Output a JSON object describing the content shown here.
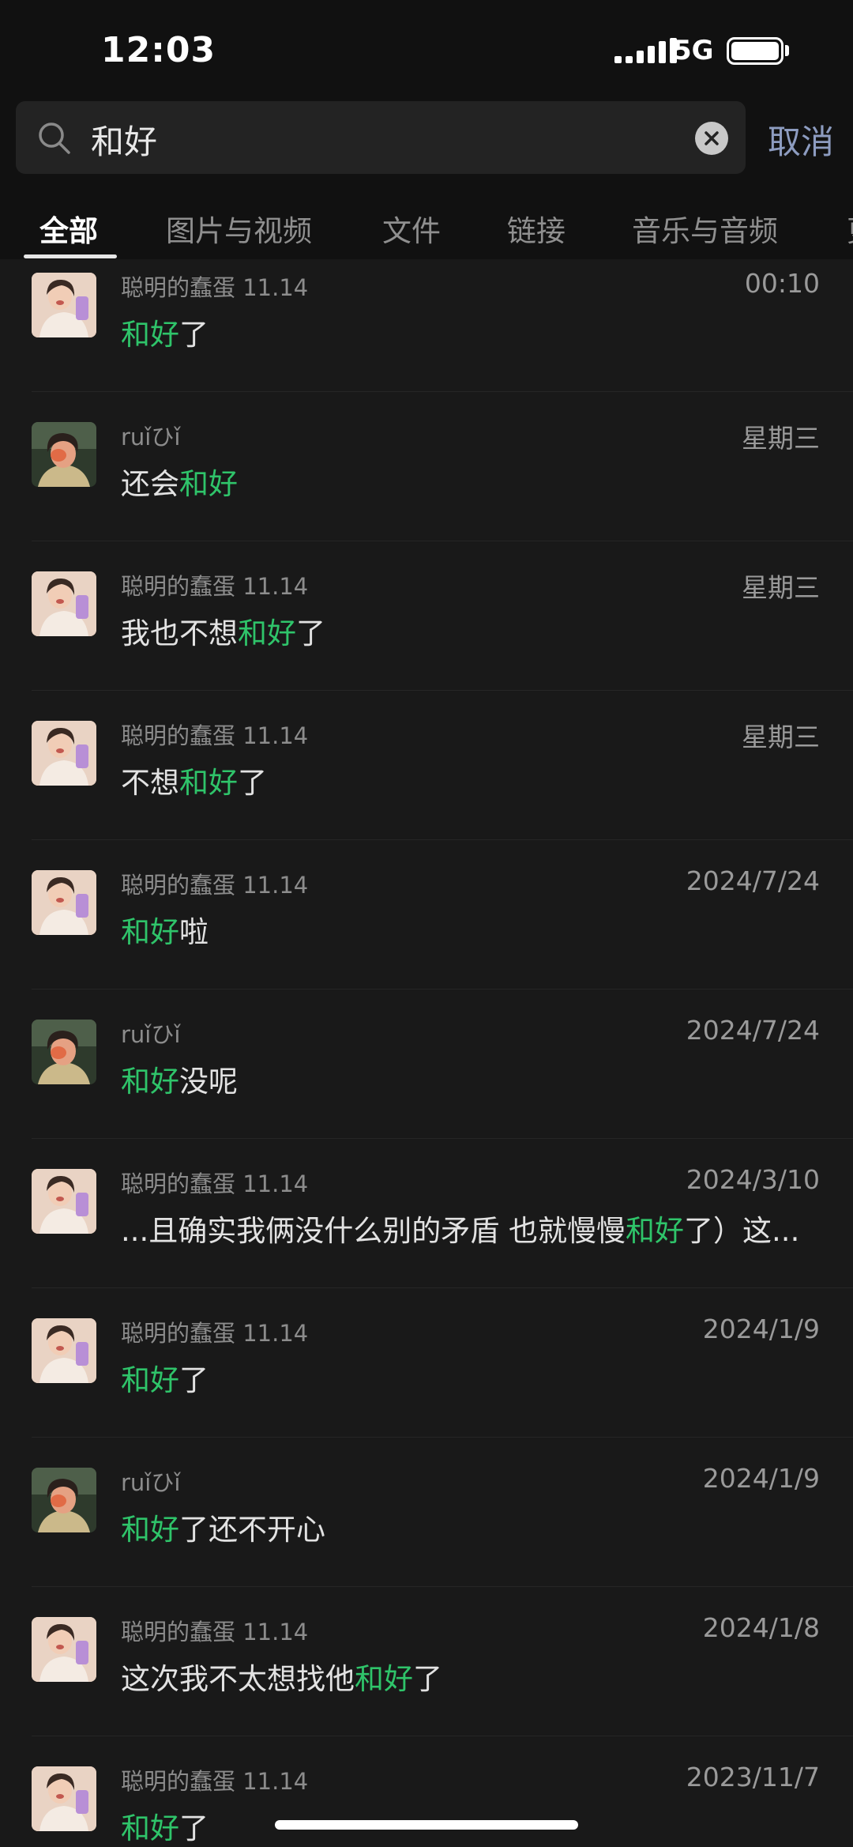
{
  "status_bar": {
    "time": "12:03",
    "network": "5G",
    "battery_level": 1.0
  },
  "search": {
    "query": "和好",
    "cancel_label": "取消"
  },
  "tabs": [
    {
      "label": "全部",
      "active": true
    },
    {
      "label": "图片与视频",
      "active": false
    },
    {
      "label": "文件",
      "active": false
    },
    {
      "label": "链接",
      "active": false
    },
    {
      "label": "音乐与音频",
      "active": false
    }
  ],
  "results": [
    {
      "sender": "聪明的蠢蛋 11.14",
      "time": "00:10",
      "avatar": "girl",
      "pre": "",
      "highlight": "和好",
      "post": "了"
    },
    {
      "sender": "ruǐひǐ",
      "time": "星期三",
      "avatar": "dark",
      "pre": "还会",
      "highlight": "和好",
      "post": ""
    },
    {
      "sender": "聪明的蠢蛋 11.14",
      "time": "星期三",
      "avatar": "girl",
      "pre": "我也不想",
      "highlight": "和好",
      "post": "了"
    },
    {
      "sender": "聪明的蠢蛋 11.14",
      "time": "星期三",
      "avatar": "girl",
      "pre": "不想",
      "highlight": "和好",
      "post": "了"
    },
    {
      "sender": "聪明的蠢蛋 11.14",
      "time": "2024/7/24",
      "avatar": "girl",
      "pre": "",
      "highlight": "和好",
      "post": "啦"
    },
    {
      "sender": "ruǐひǐ",
      "time": "2024/7/24",
      "avatar": "dark",
      "pre": "",
      "highlight": "和好",
      "post": "没呢"
    },
    {
      "sender": "聪明的蠢蛋 11.14",
      "time": "2024/3/10",
      "avatar": "girl",
      "pre": "...且确实我俩没什么别的矛盾 也就慢慢",
      "highlight": "和好",
      "post": "了）这..."
    },
    {
      "sender": "聪明的蠢蛋 11.14",
      "time": "2024/1/9",
      "avatar": "girl",
      "pre": "",
      "highlight": "和好",
      "post": "了"
    },
    {
      "sender": "ruǐひǐ",
      "time": "2024/1/9",
      "avatar": "dark",
      "pre": "",
      "highlight": "和好",
      "post": "了还不开心"
    },
    {
      "sender": "聪明的蠢蛋 11.14",
      "time": "2024/1/8",
      "avatar": "girl",
      "pre": "这次我不太想找他",
      "highlight": "和好",
      "post": "了"
    },
    {
      "sender": "聪明的蠢蛋 11.14",
      "time": "2023/11/7",
      "avatar": "girl",
      "pre": "",
      "highlight": "和好",
      "post": "了"
    }
  ],
  "colors": {
    "highlight": "#2fc46a",
    "background": "#191919",
    "cancel": "#8d9cc0"
  }
}
